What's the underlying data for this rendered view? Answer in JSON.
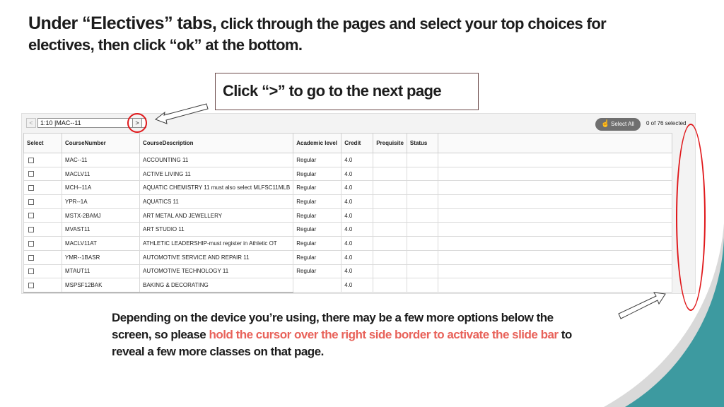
{
  "instruction": {
    "prefix": "Under “Electives” tabs,",
    "rest": " click through the pages and select your top choices for",
    "line2": "electives, then click “ok” at the bottom."
  },
  "callout": {
    "text": "Click “>” to go to the next page"
  },
  "toolbar": {
    "prev_label": "<",
    "page_select_value": "1:10 |MAC--11",
    "next_label": ">",
    "select_all_label": "Select All",
    "selected_count": "0 of 76 selected"
  },
  "table": {
    "headers": [
      "Select",
      "CourseNumber",
      "CourseDescription",
      "Academic level",
      "Credit",
      "Prequisite",
      "Status"
    ],
    "rows": [
      {
        "number": "MAC--11",
        "description": "ACCOUNTING 11",
        "level": "Regular",
        "credit": "4.0"
      },
      {
        "number": "MACLV11",
        "description": "ACTIVE LIVING 11",
        "level": "Regular",
        "credit": "4.0"
      },
      {
        "number": "MCH--11A",
        "description": "AQUATIC CHEMISTRY 11 must also select MLFSC11MLB",
        "level": "Regular",
        "credit": "4.0"
      },
      {
        "number": "YPR--1A",
        "description": "AQUATICS 11",
        "level": "Regular",
        "credit": "4.0"
      },
      {
        "number": "MSTX-2BAMJ",
        "description": "ART METAL AND JEWELLERY",
        "level": "Regular",
        "credit": "4.0"
      },
      {
        "number": "MVAST11",
        "description": "ART STUDIO 11",
        "level": "Regular",
        "credit": "4.0"
      },
      {
        "number": "MACLV11AT",
        "description": "ATHLETIC LEADERSHIP-must register in Athletic OT",
        "level": "Regular",
        "credit": "4.0"
      },
      {
        "number": "YMR--1BASR",
        "description": "AUTOMOTIVE SERVICE AND REPAIR 11",
        "level": "Regular",
        "credit": "4.0"
      },
      {
        "number": "MTAUT11",
        "description": "AUTOMOTIVE TECHNOLOGY 11",
        "level": "Regular",
        "credit": "4.0"
      },
      {
        "number": "MSPSF12BAK",
        "description": "BAKING & DECORATING",
        "level": "",
        "credit": "4.0"
      }
    ]
  },
  "note": {
    "part1": "Depending on the device you’re using, there may be a few more options below the",
    "part2": "screen, so please ",
    "highlight": "hold the cursor over the right side border to activate the slide bar",
    "part3": " to",
    "part4": "reveal a few more classes on that page."
  },
  "colors": {
    "highlight": "#e8625a",
    "annotation_red": "#e0181b",
    "teal": "#3d9aa0",
    "gray_wave": "#d9d9d9"
  }
}
